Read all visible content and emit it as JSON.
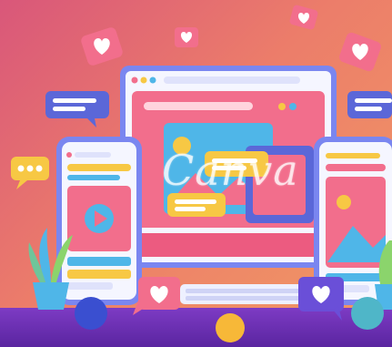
{
  "watermark": {
    "text": "Canva"
  },
  "colors": {
    "background_start": "#d9577a",
    "background_end": "#f19a63",
    "monitor_frame": "#7a86f0",
    "screen_pink": "#f26e8c",
    "accent_blue": "#4fb6e8",
    "accent_yellow": "#f7c844",
    "floor_purple": "#6a2fb0"
  },
  "icons": {
    "heart_bubble": "heart-icon",
    "message_bubble": "chat-bubble-icon",
    "play_button": "play-icon",
    "typing_bubble": "ellipsis-icon"
  }
}
